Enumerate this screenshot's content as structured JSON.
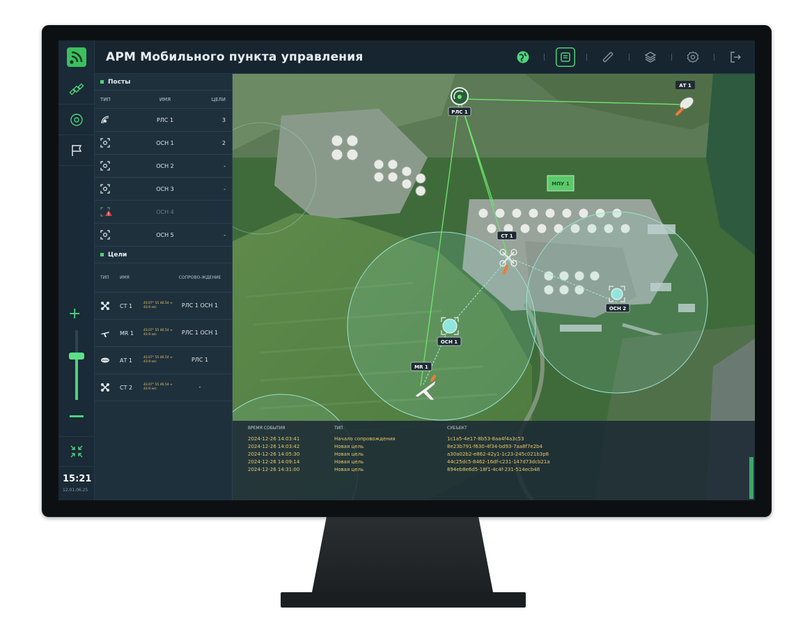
{
  "header": {
    "title": "АРМ Мобильного пункта управления"
  },
  "toolbar": [
    "globe-icon",
    "notes-icon",
    "ruler-icon",
    "layers-icon",
    "settings-icon",
    "logout-icon"
  ],
  "colors": {
    "accent": "#4fd37a",
    "panel": "#1f303d",
    "topbar": "#172530",
    "warn": "#e03b3b",
    "log_text": "#e8c96a"
  },
  "posts": {
    "title": "Посты",
    "columns": {
      "type": "ТИП",
      "name": "ИМЯ",
      "targets": "ЦЕЛИ"
    },
    "rows": [
      {
        "icon": "radar-icon",
        "name": "РЛС 1",
        "targets": "3"
      },
      {
        "icon": "camera-icon",
        "name": "ОСН 1",
        "targets": "2"
      },
      {
        "icon": "camera-icon",
        "name": "ОСН 2",
        "targets": "-"
      },
      {
        "icon": "camera-icon",
        "name": "ОСН 3",
        "targets": "-"
      },
      {
        "icon": "warning-icon",
        "name": "ОСН 4",
        "targets": ""
      },
      {
        "icon": "camera-icon",
        "name": "ОСН 5",
        "targets": "-"
      }
    ]
  },
  "targets": {
    "title": "Цели",
    "columns": {
      "type": "ТИП",
      "name": "ИМЯ",
      "tracking": "СОПРОВО-ЖДЕНИЕ"
    },
    "rows": [
      {
        "icon": "drone-icon",
        "name": "СТ 1",
        "info": "43.07° 55 46.54 ≈ 43.9 м/с",
        "tracking": "РЛС 1 ОСН 1"
      },
      {
        "icon": "plane-icon",
        "name": "МR 1",
        "info": "43.07° 55 46.54 ≈ 43.9 м/с",
        "tracking": "РЛС 1 ОСН 1"
      },
      {
        "icon": "airship-icon",
        "name": "АТ 1",
        "info": "43.07° 55 46.54 ≈ 43.9 м/с",
        "tracking": "РЛС 1"
      },
      {
        "icon": "drone-icon",
        "name": "СТ 2",
        "info": "43.07° 55 46.54 ≈ 43.9 м/с",
        "tracking": "-"
      }
    ]
  },
  "clock": {
    "time": "15:21",
    "date": "12.01.06.25"
  },
  "map_labels": {
    "rls1": "РЛС 1",
    "at1": "АТ 1",
    "mpu1": "МПУ 1",
    "st1": "СТ 1",
    "osn1": "ОСН 1",
    "osn2": "ОСН 2",
    "mr1": "МR 1"
  },
  "log": {
    "columns": {
      "time": "ВРЕМЯ СОБЫТИЯ",
      "type": "ТИП",
      "subject": "СУБЪЕКТ"
    },
    "rows": [
      {
        "time": "2024-12-26 14:03:41",
        "type": "Начало сопровождения",
        "subject": "1c1a5-4e17-8b53-8aa4f4a3c53"
      },
      {
        "time": "2024-12-26 14:03:42",
        "type": "Новая цель",
        "subject": "8e23b791-f630-4f34-bd93-7aa8f7e2b4"
      },
      {
        "time": "2024-12-26 14:05:30",
        "type": "Новая цель",
        "subject": "a30a02b2-e862-42y1-1c23-245c021b3p8"
      },
      {
        "time": "2024-12-26 14:09:14",
        "type": "Новая цель",
        "subject": "44c25dc5-8462-16df-c231-147d73dcb21a"
      },
      {
        "time": "2024-12-26 14:31:00",
        "type": "Новая цель",
        "subject": "894eb8e6d5-18f1-4c4f-231-514ecb48"
      }
    ]
  }
}
